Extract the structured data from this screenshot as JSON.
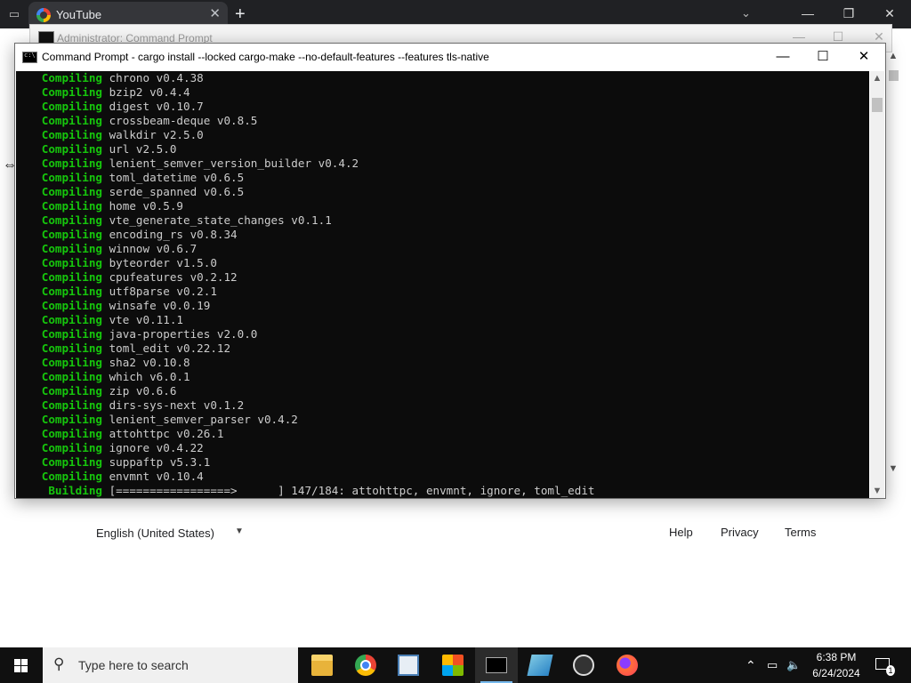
{
  "browser": {
    "tab_title": "YouTube",
    "tab_close_glyph": "✕",
    "new_tab_glyph": "+",
    "tab_list_glyph": "⌄",
    "minimize_glyph": "—",
    "restore_glyph": "❐",
    "close_glyph": "✕"
  },
  "bg_window": {
    "title": "Administrator: Command Prompt"
  },
  "cmd_window": {
    "title": "Command Prompt - cargo  install --locked cargo-make --no-default-features --features tls-native",
    "minimize_glyph": "—",
    "maximize_glyph": "☐",
    "close_glyph": "✕",
    "lines": [
      {
        "kw": "   Compiling",
        "text": " chrono v0.4.38"
      },
      {
        "kw": "   Compiling",
        "text": " bzip2 v0.4.4"
      },
      {
        "kw": "   Compiling",
        "text": " digest v0.10.7"
      },
      {
        "kw": "   Compiling",
        "text": " crossbeam-deque v0.8.5"
      },
      {
        "kw": "   Compiling",
        "text": " walkdir v2.5.0"
      },
      {
        "kw": "   Compiling",
        "text": " url v2.5.0"
      },
      {
        "kw": "   Compiling",
        "text": " lenient_semver_version_builder v0.4.2"
      },
      {
        "kw": "   Compiling",
        "text": " toml_datetime v0.6.5"
      },
      {
        "kw": "   Compiling",
        "text": " serde_spanned v0.6.5"
      },
      {
        "kw": "   Compiling",
        "text": " home v0.5.9"
      },
      {
        "kw": "   Compiling",
        "text": " vte_generate_state_changes v0.1.1"
      },
      {
        "kw": "   Compiling",
        "text": " encoding_rs v0.8.34"
      },
      {
        "kw": "   Compiling",
        "text": " winnow v0.6.7"
      },
      {
        "kw": "   Compiling",
        "text": " byteorder v1.5.0"
      },
      {
        "kw": "   Compiling",
        "text": " cpufeatures v0.2.12"
      },
      {
        "kw": "   Compiling",
        "text": " utf8parse v0.2.1"
      },
      {
        "kw": "   Compiling",
        "text": " winsafe v0.0.19"
      },
      {
        "kw": "   Compiling",
        "text": " vte v0.11.1"
      },
      {
        "kw": "   Compiling",
        "text": " java-properties v2.0.0"
      },
      {
        "kw": "   Compiling",
        "text": " toml_edit v0.22.12"
      },
      {
        "kw": "   Compiling",
        "text": " sha2 v0.10.8"
      },
      {
        "kw": "   Compiling",
        "text": " which v6.0.1"
      },
      {
        "kw": "   Compiling",
        "text": " zip v0.6.6"
      },
      {
        "kw": "   Compiling",
        "text": " dirs-sys-next v0.1.2"
      },
      {
        "kw": "   Compiling",
        "text": " lenient_semver_parser v0.4.2"
      },
      {
        "kw": "   Compiling",
        "text": " attohttpc v0.26.1"
      },
      {
        "kw": "   Compiling",
        "text": " ignore v0.4.22"
      },
      {
        "kw": "   Compiling",
        "text": " suppaftp v5.3.1"
      },
      {
        "kw": "   Compiling",
        "text": " envmnt v0.10.4"
      },
      {
        "kw": "    Building",
        "text": " [=================>      ] 147/184: attohttpc, envmnt, ignore, toml_edit"
      }
    ],
    "scroll_up_glyph": "▲",
    "scroll_down_glyph": "▼"
  },
  "footer": {
    "language": "English (United States)",
    "language_caret": "▼",
    "links": [
      "Help",
      "Privacy",
      "Terms"
    ]
  },
  "taskbar": {
    "search_placeholder": "Type here to search",
    "search_glyph": "⚲",
    "apps": [
      "file-explorer",
      "chrome",
      "control-panel",
      "store",
      "command-prompt",
      "notepad",
      "obs",
      "firefox"
    ],
    "tray_up_glyph": "⌃",
    "time": "6:38 PM",
    "date": "6/24/2024",
    "notification_count": "1"
  },
  "colors": {
    "console_bg": "#0c0c0c",
    "console_keyword": "#16c60c",
    "console_text": "#cccccc",
    "taskbar_bg": "#101010"
  }
}
